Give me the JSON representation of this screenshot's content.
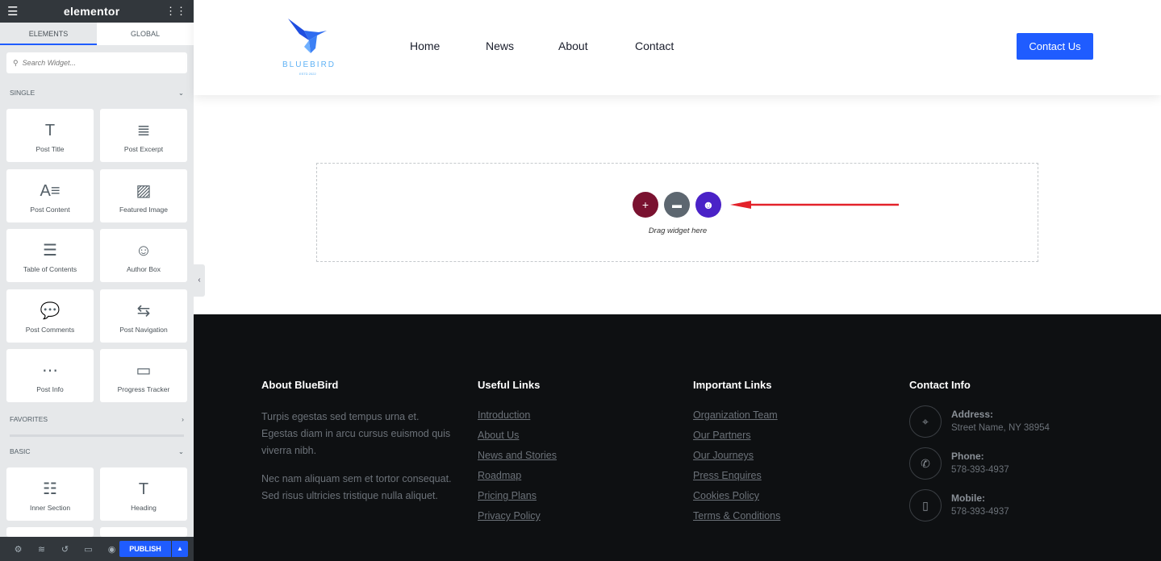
{
  "editor": {
    "brand": "elementor",
    "tabs": [
      "ELEMENTS",
      "GLOBAL"
    ],
    "search_placeholder": "Search Widget...",
    "categories": {
      "single": "SINGLE",
      "favorites": "FAVORITES",
      "basic": "BASIC"
    },
    "single_widgets": [
      {
        "label": "Post Title",
        "icon": "T"
      },
      {
        "label": "Post Excerpt",
        "icon": "≣"
      },
      {
        "label": "Post Content",
        "icon": "A≡"
      },
      {
        "label": "Featured Image",
        "icon": "▨"
      },
      {
        "label": "Table of Contents",
        "icon": "☰"
      },
      {
        "label": "Author Box",
        "icon": "☺"
      },
      {
        "label": "Post Comments",
        "icon": "💬"
      },
      {
        "label": "Post Navigation",
        "icon": "⇆"
      },
      {
        "label": "Post Info",
        "icon": "⋯"
      },
      {
        "label": "Progress Tracker",
        "icon": "▭"
      }
    ],
    "basic_widgets": [
      {
        "label": "Inner Section",
        "icon": "☷"
      },
      {
        "label": "Heading",
        "icon": "T"
      }
    ],
    "publish": "PUBLISH"
  },
  "site": {
    "logo_text": "BLUEBIRD",
    "logo_sub": "ESTD 2022",
    "nav": [
      "Home",
      "News",
      "About",
      "Contact"
    ],
    "cta": "Contact Us"
  },
  "canvas": {
    "drag_text": "Drag widget here",
    "colors": {
      "add": "#7a1230",
      "template": "#5d6770",
      "ai": "#4a22c7",
      "arrow": "#e3222a"
    }
  },
  "footer": {
    "about": {
      "title": "About BlueBird",
      "p1": "Turpis egestas sed tempus urna et. Egestas diam in arcu cursus euismod quis viverra nibh.",
      "p2": "Nec nam aliquam sem et tortor consequat. Sed risus ultricies tristique nulla aliquet."
    },
    "useful": {
      "title": "Useful Links",
      "links": [
        "Introduction",
        "About Us",
        "News and Stories",
        "Roadmap",
        "Pricing Plans",
        "Privacy Policy"
      ]
    },
    "important": {
      "title": "Important Links",
      "links": [
        "Organization Team",
        "Our Partners",
        "Our Journeys",
        "Press Enquires",
        "Cookies Policy",
        "Terms & Conditions"
      ]
    },
    "contact": {
      "title": "Contact Info",
      "items": [
        {
          "label": "Address:",
          "value": "Street Name, NY 38954",
          "icon": "map-pin"
        },
        {
          "label": "Phone:",
          "value": "578-393-4937",
          "icon": "phone"
        },
        {
          "label": "Mobile:",
          "value": "578-393-4937",
          "icon": "mobile"
        }
      ]
    }
  }
}
